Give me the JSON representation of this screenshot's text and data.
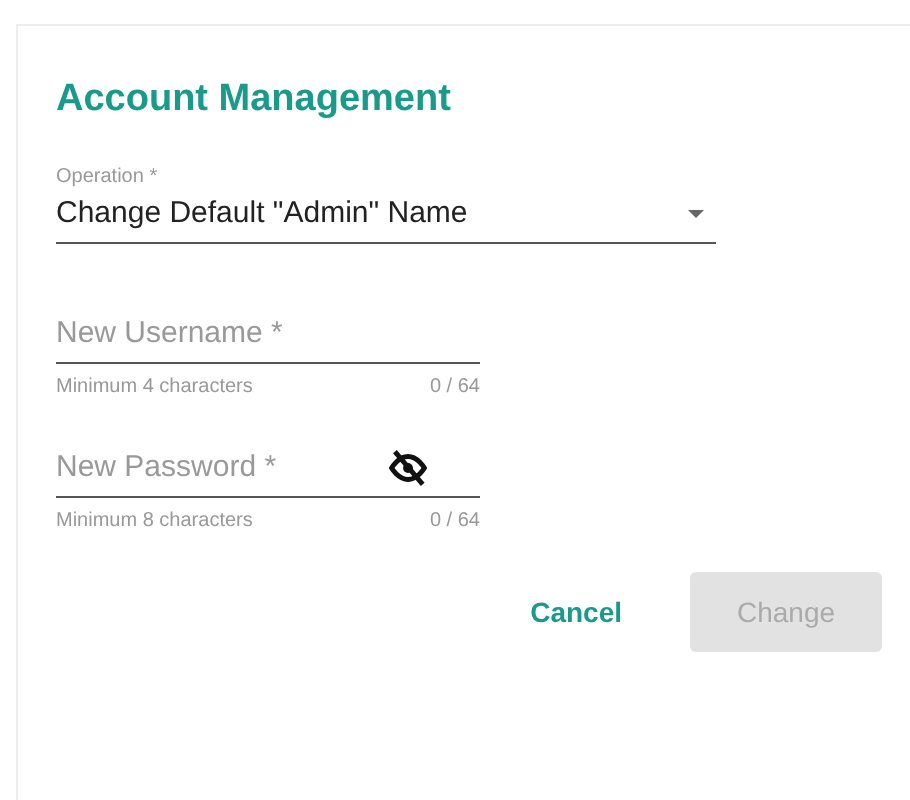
{
  "dialog": {
    "title": "Account Management",
    "operation": {
      "label": "Operation *",
      "value": "Change Default \"Admin\" Name"
    },
    "fields": [
      {
        "kind": "text",
        "placeholder": "New Username *",
        "hint": "Minimum 4 characters",
        "counter": "0 / 64"
      },
      {
        "kind": "password",
        "placeholder": "New Password *",
        "hint": "Minimum 8 characters",
        "counter": "0 / 64"
      }
    ],
    "buttons": [
      {
        "kind": "flat",
        "label": "Cancel",
        "disabled": false
      },
      {
        "kind": "raised",
        "label": "Change",
        "disabled": true
      }
    ]
  }
}
